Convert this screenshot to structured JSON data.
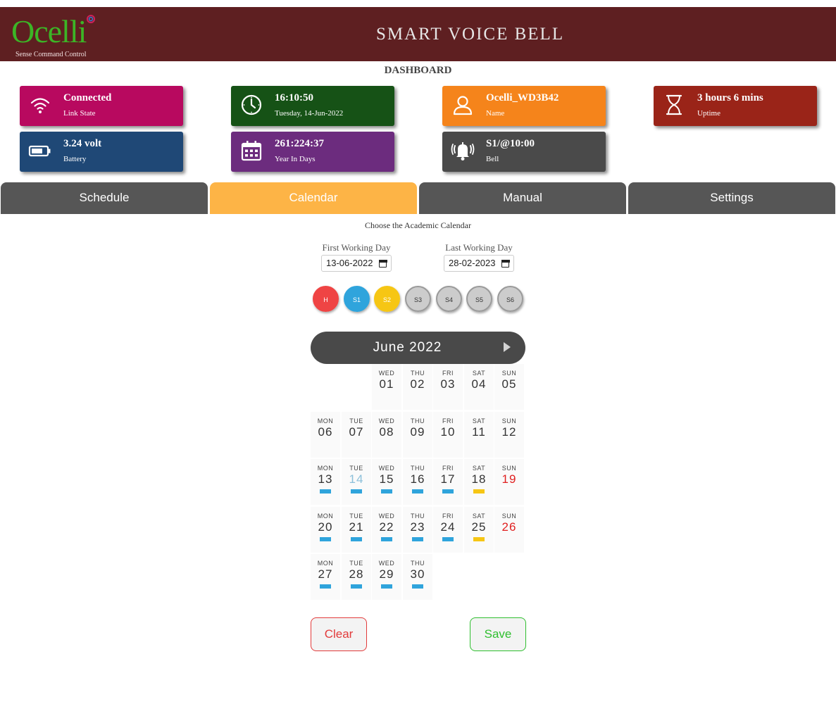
{
  "header": {
    "logo_text": "Ocelli",
    "logo_tagline": "Sense Command Control",
    "title": "SMART VOICE BELL"
  },
  "dashboard": {
    "title": "DASHBOARD",
    "cards": [
      {
        "value": "Connected",
        "label": "Link State",
        "icon": "wifi-icon",
        "color": "#b8095f"
      },
      {
        "value": "16:10:50",
        "label": "Tuesday, 14-Jun-2022",
        "icon": "clock-icon",
        "color": "#165216"
      },
      {
        "value": "Ocelli_WD3B42",
        "label": "Name",
        "icon": "user-icon",
        "color": "#f5841b"
      },
      {
        "value": "3 hours 6 mins",
        "label": "Uptime",
        "icon": "hourglass-icon",
        "color": "#9a2418"
      },
      {
        "value": "3.24 volt",
        "label": "Battery",
        "icon": "battery-icon",
        "color": "#1f4876"
      },
      {
        "value": "261:224:37",
        "label": "Year In Days",
        "icon": "calendar-icon",
        "color": "#6c2c7e"
      },
      {
        "value": "S1/@10:00",
        "label": "Bell",
        "icon": "bell-icon",
        "color": "#4a4a4a"
      }
    ]
  },
  "tabs": [
    "Schedule",
    "Calendar",
    "Manual",
    "Settings"
  ],
  "active_tab": "Calendar",
  "calendar_page": {
    "subtitle": "Choose the Academic Calendar",
    "first_day": {
      "label": "First Working Day",
      "value": "13-06-2022"
    },
    "last_day": {
      "label": "Last Working Day",
      "value": "28-02-2023"
    },
    "schedules": [
      {
        "label": "H",
        "color": "#ef4444"
      },
      {
        "label": "S1",
        "color": "#2fa4dc"
      },
      {
        "label": "S2",
        "color": "#f6c614"
      },
      {
        "label": "S3",
        "color": "#cccccc"
      },
      {
        "label": "S4",
        "color": "#cccccc"
      },
      {
        "label": "S5",
        "color": "#cccccc"
      },
      {
        "label": "S6",
        "color": "#cccccc"
      }
    ],
    "month_label": "June 2022",
    "days": [
      {
        "dow": "WED",
        "date": "01",
        "mark": null
      },
      {
        "dow": "THU",
        "date": "02",
        "mark": null
      },
      {
        "dow": "FRI",
        "date": "03",
        "mark": null
      },
      {
        "dow": "SAT",
        "date": "04",
        "mark": null
      },
      {
        "dow": "SUN",
        "date": "05",
        "mark": null
      },
      {
        "dow": "MON",
        "date": "06",
        "mark": null
      },
      {
        "dow": "TUE",
        "date": "07",
        "mark": null
      },
      {
        "dow": "WED",
        "date": "08",
        "mark": null
      },
      {
        "dow": "THU",
        "date": "09",
        "mark": null
      },
      {
        "dow": "FRI",
        "date": "10",
        "mark": null
      },
      {
        "dow": "SAT",
        "date": "11",
        "mark": null
      },
      {
        "dow": "SUN",
        "date": "12",
        "mark": null
      },
      {
        "dow": "MON",
        "date": "13",
        "mark": "S1"
      },
      {
        "dow": "TUE",
        "date": "14",
        "mark": "S1",
        "today": true
      },
      {
        "dow": "WED",
        "date": "15",
        "mark": "S1"
      },
      {
        "dow": "THU",
        "date": "16",
        "mark": "S1"
      },
      {
        "dow": "FRI",
        "date": "17",
        "mark": "S1"
      },
      {
        "dow": "SAT",
        "date": "18",
        "mark": "S2"
      },
      {
        "dow": "SUN",
        "date": "19",
        "mark": "H"
      },
      {
        "dow": "MON",
        "date": "20",
        "mark": "S1"
      },
      {
        "dow": "TUE",
        "date": "21",
        "mark": "S1"
      },
      {
        "dow": "WED",
        "date": "22",
        "mark": "S1"
      },
      {
        "dow": "THU",
        "date": "23",
        "mark": "S1"
      },
      {
        "dow": "FRI",
        "date": "24",
        "mark": "S1"
      },
      {
        "dow": "SAT",
        "date": "25",
        "mark": "S2"
      },
      {
        "dow": "SUN",
        "date": "26",
        "mark": "H"
      },
      {
        "dow": "MON",
        "date": "27",
        "mark": "S1"
      },
      {
        "dow": "TUE",
        "date": "28",
        "mark": "S1"
      },
      {
        "dow": "WED",
        "date": "29",
        "mark": "S1"
      },
      {
        "dow": "THU",
        "date": "30",
        "mark": "S1"
      }
    ],
    "clear_label": "Clear",
    "save_label": "Save"
  },
  "colors": {
    "header_bg": "#5e1f21",
    "tab_bg": "#565656",
    "tab_active_bg": "#fdb446",
    "clear": "#e23b3b",
    "save": "#2fbf2f",
    "today_text": "#8cc0da",
    "holiday_text": "#e02020"
  }
}
